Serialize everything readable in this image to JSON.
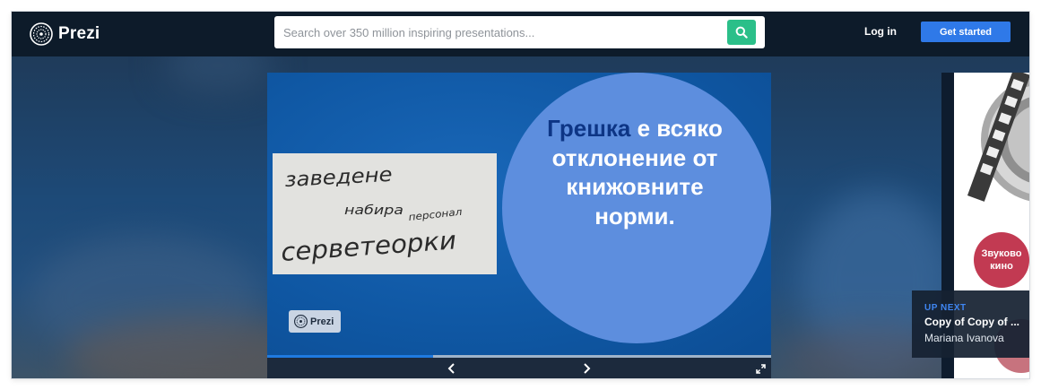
{
  "header": {
    "brand": "Prezi",
    "search_placeholder": "Search over 350 million inspiring presentations...",
    "login_label": "Log in",
    "get_started_label": "Get started"
  },
  "slide": {
    "text_highlight": "Грешка",
    "text_rest": "е всяко отклонение от книжовните норми.",
    "photo_handwriting": [
      "заведене",
      "набира",
      "персонал",
      "серветеорки"
    ],
    "watermark_label": "Prezi"
  },
  "player": {
    "progress": 0.33
  },
  "up_next": {
    "label": "UP NEXT",
    "title": "Copy of Copy of ...",
    "author": "Mariana Ivanova",
    "badge": "Звуково кино"
  },
  "colors": {
    "topbar": "#0d1b2a",
    "search_button": "#2bbf89",
    "cta": "#2f79e8",
    "slide_bg": "#0f5aa9",
    "circle": "#5d8ede",
    "highlight": "#0d3585",
    "progress": "#1f7ae0",
    "badge": "#c23a52",
    "upnext_label": "#3f86f2"
  },
  "icons": {
    "logo": "prezi-logo-icon",
    "search": "search-icon",
    "prev": "chevron-left-icon",
    "next": "chevron-right-icon",
    "fullscreen": "fullscreen-icon"
  }
}
